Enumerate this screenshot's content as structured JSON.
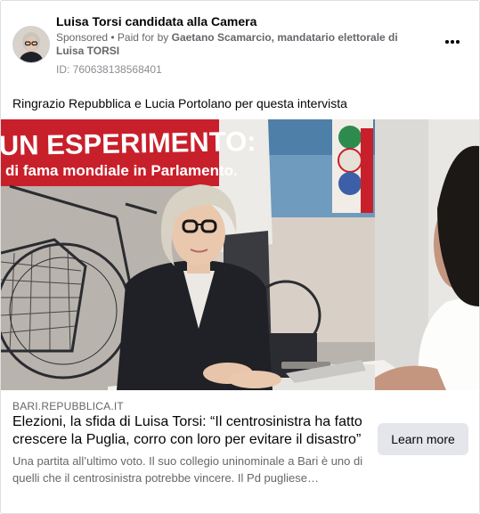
{
  "post": {
    "page_name": "Luisa Torsi candidata alla Camera",
    "sponsored_label": "Sponsored",
    "paid_prefix": " • Paid for by ",
    "paid_by": "Gaetano Scamarcio, mandatario elettorale di Luisa TORSI",
    "ad_id": "ID: 760638138568401",
    "text": "Ringrazio Repubblica e Lucia Portolano per questa intervista",
    "more_icon": "ellipsis-icon"
  },
  "media": {
    "banner_line1": "UN ESPERIMENTO:",
    "banner_line2": "di fama mondiale in Parlamento.",
    "colors": {
      "banner_red": "#c8202b",
      "poster_red": "#c8202b"
    }
  },
  "link": {
    "domain": "BARI.REPUBBLICA.IT",
    "title": "Elezioni, la sfida di Luisa Torsi: “Il centrosinistra ha fatto crescere la Puglia, corro con loro per evitare il disastro”",
    "description": "Una partita all’ultimo voto. Il suo collegio uninominale a Bari è uno di quelli che il centrosinistra potrebbe vincere. Il Pd pugliese…",
    "cta": "Learn more"
  }
}
